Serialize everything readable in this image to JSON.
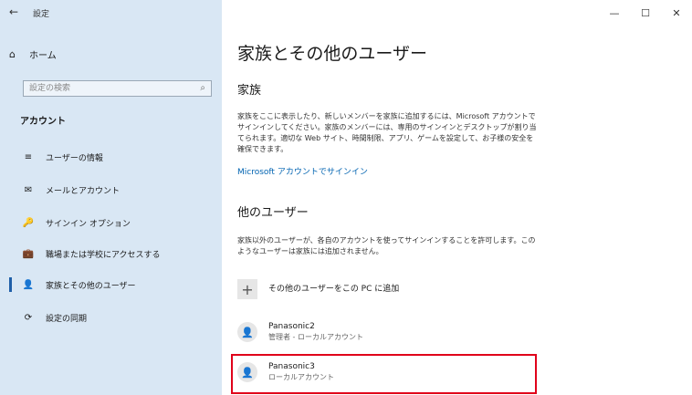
{
  "window": {
    "back": "←",
    "title": "設定",
    "min": "—",
    "max": "☐",
    "close": "✕"
  },
  "sidebar": {
    "home": {
      "icon": "⌂",
      "label": "ホーム"
    },
    "search": {
      "placeholder": "設定の検索",
      "icon": "⌕"
    },
    "section": "アカウント",
    "items": [
      {
        "icon": "≡",
        "label": "ユーザーの情報"
      },
      {
        "icon": "✉",
        "label": "メールとアカウント"
      },
      {
        "icon": "🔑",
        "label": "サインイン オプション"
      },
      {
        "icon": "💼",
        "label": "職場または学校にアクセスする"
      },
      {
        "icon": "👤",
        "label": "家族とその他のユーザー"
      },
      {
        "icon": "⟳",
        "label": "設定の同期"
      }
    ]
  },
  "main": {
    "title": "家族とその他のユーザー",
    "family": {
      "heading": "家族",
      "description": "家族をここに表示したり、新しいメンバーを家族に追加するには、Microsoft アカウントでサインインしてください。家族のメンバーには、専用のサインインとデスクトップが割り当てられます。適切な Web サイト、時間制限、アプリ、ゲームを設定して、お子様の安全を確保できます。",
      "link": "Microsoft アカウントでサインイン"
    },
    "others": {
      "heading": "他のユーザー",
      "description": "家族以外のユーザーが、各自のアカウントを使ってサインインすることを許可します。このようなユーザーは家族には追加されません。",
      "add_label": "その他のユーザーをこの PC に追加",
      "add_icon": "+",
      "users": [
        {
          "icon": "👤",
          "name": "Panasonic2",
          "role": "管理者 - ローカルアカウント"
        },
        {
          "icon": "👤",
          "name": "Panasonic3",
          "role": "ローカルアカウント"
        }
      ]
    }
  }
}
